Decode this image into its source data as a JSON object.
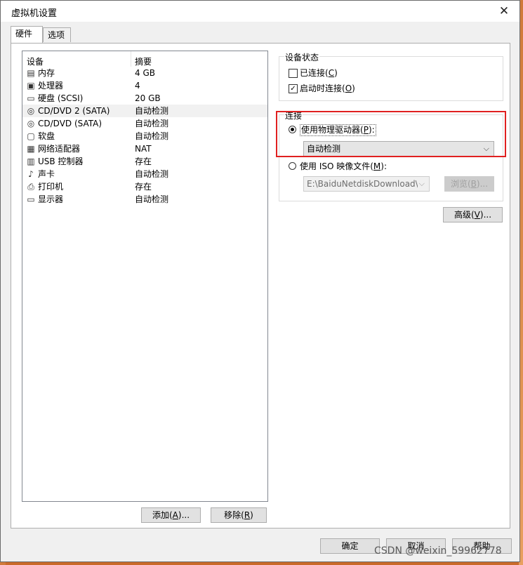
{
  "window": {
    "title": "虚拟机设置",
    "close_glyph": "✕"
  },
  "tabs": [
    {
      "label": "硬件",
      "active": true
    },
    {
      "label": "选项",
      "active": false
    }
  ],
  "device_list": {
    "columns": [
      "设备",
      "摘要"
    ],
    "rows": [
      {
        "icon": "memory-icon",
        "glyph": "▤",
        "name": "内存",
        "summary": "4 GB",
        "selected": false
      },
      {
        "icon": "processor-icon",
        "glyph": "▣",
        "name": "处理器",
        "summary": "4",
        "selected": false
      },
      {
        "icon": "harddisk-icon",
        "glyph": "▭",
        "name": "硬盘 (SCSI)",
        "summary": "20 GB",
        "selected": false
      },
      {
        "icon": "cd-dvd-icon",
        "glyph": "◎",
        "name": "CD/DVD 2 (SATA)",
        "summary": "自动检测",
        "selected": true
      },
      {
        "icon": "cd-dvd-icon",
        "glyph": "◎",
        "name": "CD/DVD (SATA)",
        "summary": "自动检测",
        "selected": false
      },
      {
        "icon": "floppy-icon",
        "glyph": "▢",
        "name": "软盘",
        "summary": "自动检测",
        "selected": false
      },
      {
        "icon": "network-icon",
        "glyph": "▦",
        "name": "网络适配器",
        "summary": "NAT",
        "selected": false
      },
      {
        "icon": "usb-icon",
        "glyph": "▥",
        "name": "USB 控制器",
        "summary": "存在",
        "selected": false
      },
      {
        "icon": "sound-icon",
        "glyph": "♪",
        "name": "声卡",
        "summary": "自动检测",
        "selected": false
      },
      {
        "icon": "printer-icon",
        "glyph": "⎙",
        "name": "打印机",
        "summary": "存在",
        "selected": false
      },
      {
        "icon": "display-icon",
        "glyph": "▭",
        "name": "显示器",
        "summary": "自动检测",
        "selected": false
      }
    ]
  },
  "list_buttons": {
    "add_label": "添加",
    "add_key": "A",
    "add_suffix": "...",
    "remove_label": "移除",
    "remove_key": "R"
  },
  "device_status": {
    "title": "设备状态",
    "connected": {
      "label": "已连接",
      "key": "C",
      "checked": false
    },
    "connect_at_power_on": {
      "label": "启动时连接",
      "key": "O",
      "checked": true
    }
  },
  "connection": {
    "title": "连接",
    "physical_drive": {
      "label": "使用物理驱动器",
      "key": "P",
      "suffix": ":",
      "selected": true
    },
    "drive_select_value": "自动检测",
    "iso": {
      "label": "使用 ISO 映像文件",
      "key": "M",
      "suffix": ":",
      "selected": false
    },
    "iso_path_value": "E:\\BaiduNetdiskDownload\\Li",
    "browse_label": "浏览",
    "browse_key": "B",
    "browse_suffix": "..."
  },
  "advanced": {
    "label": "高级",
    "key": "V",
    "suffix": "..."
  },
  "footer": {
    "ok_label": "确定",
    "cancel_label": "取消",
    "help_label": "帮助"
  },
  "watermark": "CSDN @weixin_59962778",
  "colors": {
    "highlight_box": "#e02020",
    "selected_row": "#f1f1f1"
  }
}
